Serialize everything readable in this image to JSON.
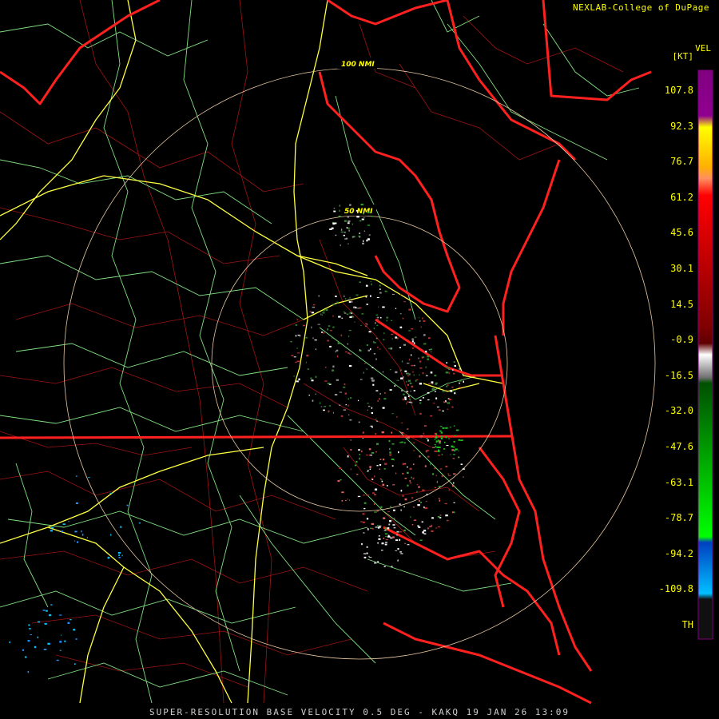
{
  "credit": "NEXLAB-College of DuPage",
  "footer": "SUPER-RESOLUTION BASE VELOCITY 0.5 DEG - KAKQ 19 JAN 26 13:09",
  "legend": {
    "product": "VEL",
    "unit": "[KT]",
    "ticks": [
      "107.8",
      "92.3",
      "76.7",
      "61.2",
      "45.6",
      "30.1",
      "14.5",
      "-0.9",
      "-16.5",
      "-32.0",
      "-47.6",
      "-63.1",
      "-78.7",
      "-94.2",
      "-109.8",
      "TH"
    ]
  },
  "range_rings": [
    {
      "label": "50 NMI"
    },
    {
      "label": "100 NMI"
    }
  ],
  "colors": {
    "state_border": "#ff2020",
    "county_border": "#b01818",
    "road": "#90ee90",
    "interstate": "#ffff40",
    "ring": "#e8c8a0",
    "text": "#ffff00"
  }
}
